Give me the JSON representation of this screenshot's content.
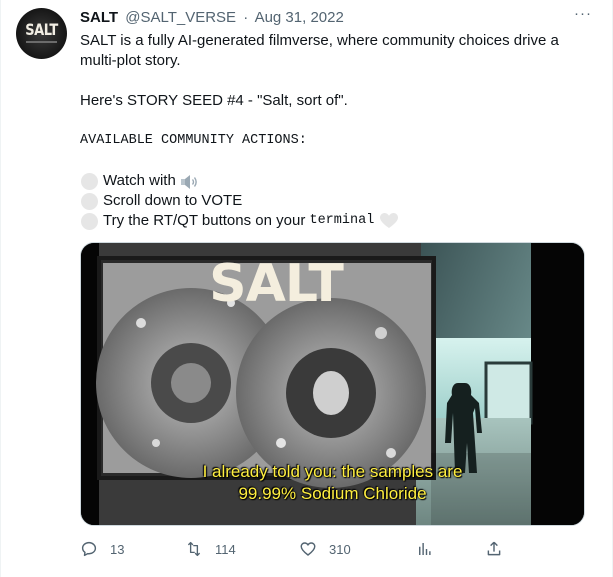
{
  "author": {
    "name": "SALT",
    "handle": "@SALT_VERSE",
    "separator": "·",
    "date": "Aug 31, 2022",
    "avatar_text": "SALT",
    "avatar_icon": "salt-logo-avatar"
  },
  "more_icon": "more-icon",
  "more_label": "···",
  "tweet": {
    "line1": "SALT is a fully AI-generated filmverse, where community choices drive a",
    "line2": "multi-plot story.",
    "line3": "Here's STORY SEED #4 - \"Salt, sort of\".",
    "actions_heading": "AVAILABLE COMMUNITY ACTIONS:",
    "action1": "Watch with",
    "action2": "Scroll down to VOTE",
    "action3_prefix": "Try the RT/QT buttons on your ",
    "action3_code": "terminal",
    "action_bullet_icon": "white-circle-icon",
    "speaker_icon": "speaker-icon",
    "heart_icon": "white-heart-icon"
  },
  "media": {
    "title_text": "SALT",
    "subtitle_line1": "I already told you: the samples are",
    "subtitle_line2": "99.99% Sodium Chloride"
  },
  "engagement": {
    "replies": "13",
    "retweets": "114",
    "likes": "310",
    "reply_icon": "reply-icon",
    "retweet_icon": "retweet-icon",
    "like_icon": "like-icon",
    "views_icon": "views-chart-icon",
    "share_icon": "share-icon"
  },
  "colors": {
    "text": "#0f1419",
    "secondary": "#536471",
    "subtitle_yellow": "#ffef40"
  }
}
